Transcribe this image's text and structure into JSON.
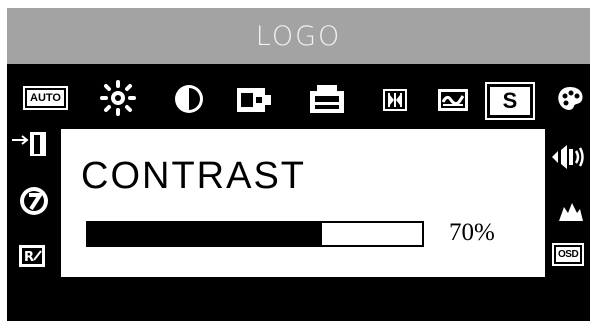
{
  "header": {
    "logo": "LOGO"
  },
  "toolbar": {
    "auto_label": "AUTO",
    "s_label": "S",
    "osd_label": "OSD",
    "icons": [
      "auto-icon",
      "brightness-icon",
      "contrast-icon",
      "h-position-icon",
      "v-position-icon",
      "clock-icon",
      "phase-icon",
      "sharpness-icon",
      "color-icon"
    ]
  },
  "side_left": [
    "exit-icon",
    "language-icon",
    "reset-icon"
  ],
  "side_right": [
    "volume-icon",
    "osd-position-icon",
    "osd-settings-icon"
  ],
  "panel": {
    "title": "CONTRAST",
    "value_label": "70%",
    "value": 0.7
  },
  "colors": {
    "header_bg": "#a3a3a3",
    "osd_bg": "#000000",
    "panel_bg": "#ffffff"
  }
}
